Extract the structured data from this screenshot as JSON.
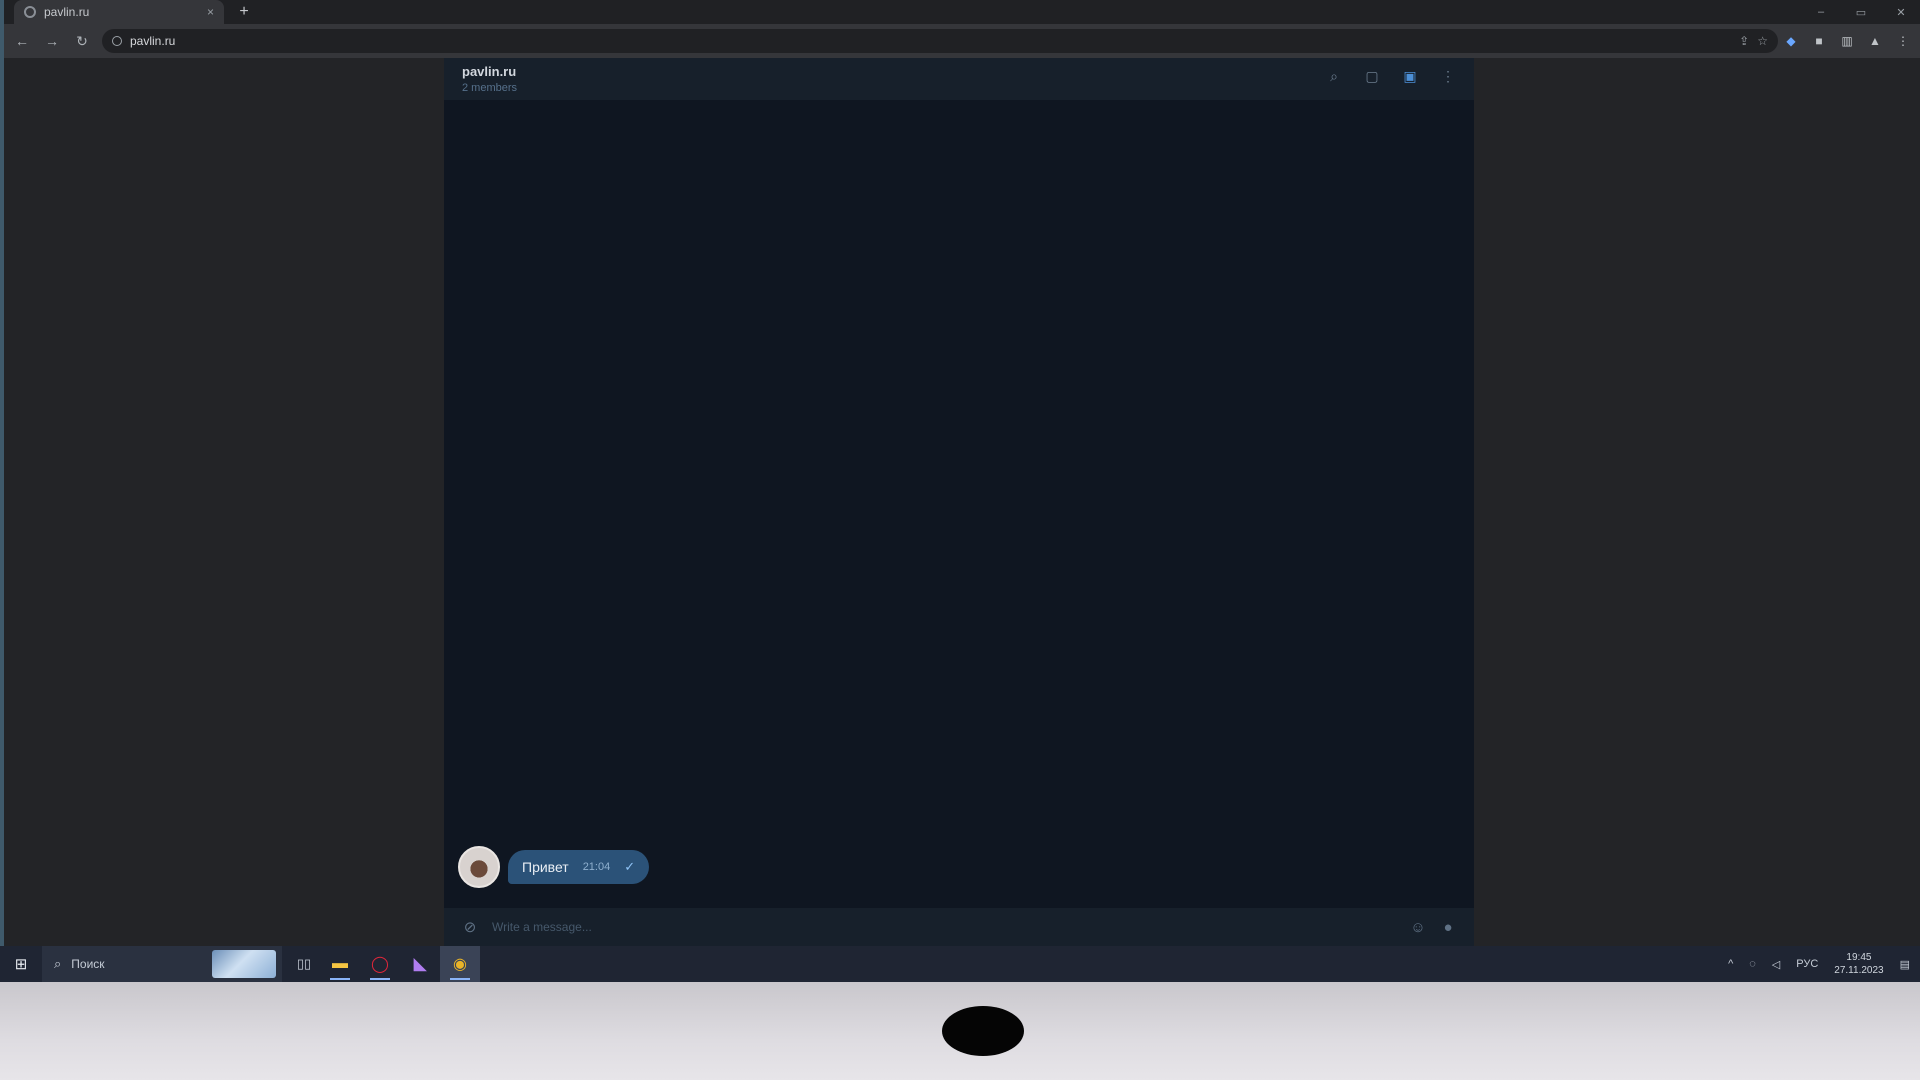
{
  "browser": {
    "tab_title": "pavlin.ru",
    "tab_close": "×",
    "new_tab": "+",
    "url": "pavlin.ru",
    "window_controls": [
      "–",
      "▭",
      "✕"
    ]
  },
  "chat": {
    "title": "pavlin.ru",
    "subtitle": "2 members",
    "message": {
      "text": "Привет",
      "time": "21:04"
    },
    "composer_placeholder": "Write a message..."
  },
  "taskbar": {
    "search_text": "Поиск",
    "tray_lang": "РУС",
    "time": "19:45",
    "date": "27.11.2023"
  },
  "icons": {
    "back": "back-arrow-icon",
    "forward": "forward-arrow-icon",
    "reload": "reload-icon",
    "search": "search-icon",
    "comments": "comments-icon",
    "sidebar": "sidebar-toggle-icon",
    "menu": "more-vertical-icon",
    "attach": "paperclip-icon",
    "emoji": "emoji-icon",
    "mic": "microphone-icon"
  },
  "colors": {
    "chat_bg": "#0f1621",
    "bubble": "#2b5278",
    "taskbar": "#1f2533"
  }
}
